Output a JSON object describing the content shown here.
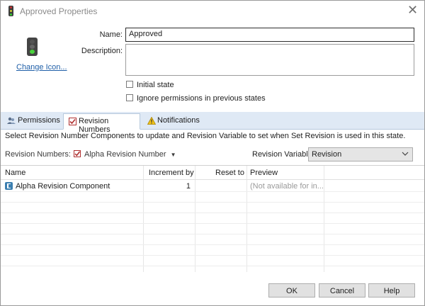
{
  "window": {
    "title": "Approved Properties",
    "close_icon": "close-icon"
  },
  "state": {
    "icon": "traffic-light-icon",
    "change_icon_label": "Change Icon...",
    "name_label": "Name:",
    "name_value": "Approved",
    "description_label": "Description:",
    "description_value": "",
    "initial_state_label": "Initial state",
    "initial_state_checked": false,
    "ignore_permissions_label": "Ignore permissions in previous states",
    "ignore_permissions_checked": false
  },
  "tabs": [
    {
      "label": "Permissions",
      "icon": "users-icon",
      "active": false
    },
    {
      "label": "Revision Numbers",
      "icon": "checkbox-icon",
      "active": true
    },
    {
      "label": "Notifications",
      "icon": "warning-icon",
      "active": false
    }
  ],
  "revision_tab": {
    "instruction": "Select Revision Number Components to update and Revision Variable to set when Set Revision is used in this state.",
    "revision_numbers_label": "Revision Numbers:",
    "revision_numbers_value": "Alpha Revision Number",
    "revision_variable_label": "Revision Variable:",
    "revision_variable_value": "Revision",
    "columns": [
      "Name",
      "Increment by",
      "Reset to",
      "Preview"
    ],
    "rows": [
      {
        "name": "Alpha Revision Component",
        "increment_by": "1",
        "reset_to": "",
        "preview": "(Not available for in..."
      }
    ]
  },
  "buttons": {
    "ok": "OK",
    "cancel": "Cancel",
    "help": "Help"
  },
  "colors": {
    "tabbar": "#dfe9f5",
    "link": "#1f5fa8",
    "accent_red": "#b03030"
  }
}
